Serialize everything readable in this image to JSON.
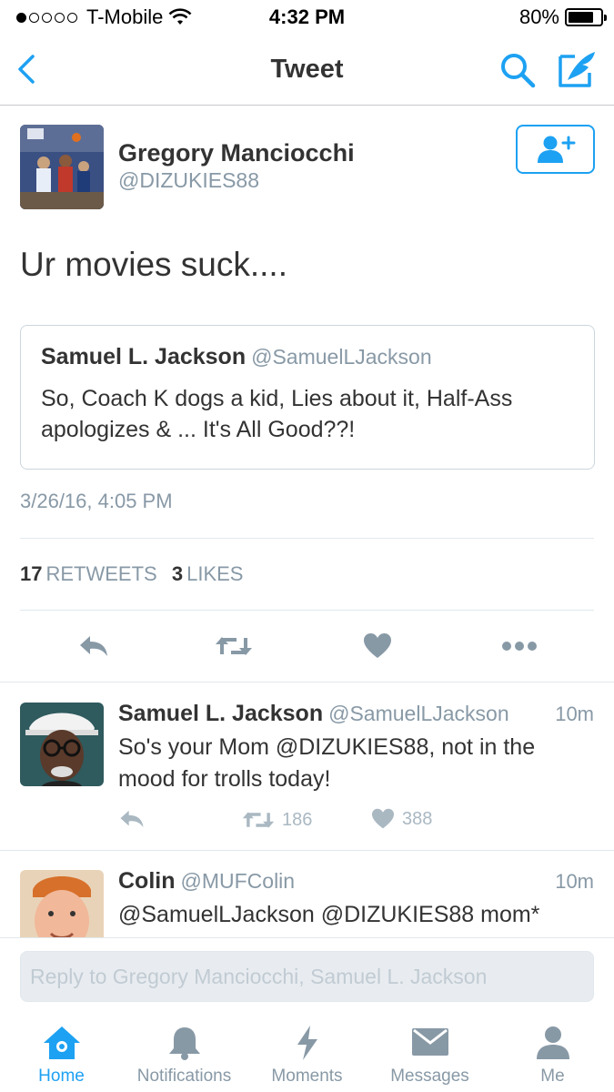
{
  "status_bar": {
    "carrier": "T-Mobile",
    "time": "4:32 PM",
    "battery": "80%",
    "battery_level": 0.8,
    "signal_bars": 1
  },
  "nav": {
    "title": "Tweet",
    "back_icon": "chevron-left-icon",
    "search_icon": "search-icon",
    "compose_icon": "compose-tweet-icon"
  },
  "tweet": {
    "author_name": "Gregory Manciocchi",
    "author_handle": "@DIZUKIES88",
    "text": "Ur movies suck....",
    "quoted": {
      "name": "Samuel L. Jackson",
      "handle": "@SamuelLJackson",
      "text": "So, Coach K dogs a kid, Lies about it, Half-Ass apologizes & ... It's All Good??!"
    },
    "timestamp": "3/26/16, 4:05 PM",
    "retweets_count": "17",
    "retweets_label": "RETWEETS",
    "likes_count": "3",
    "likes_label": "LIKES"
  },
  "replies": [
    {
      "name": "Samuel L. Jackson",
      "handle": "@SamuelLJackson",
      "time": "10m",
      "text": "So's your Mom @DIZUKIES88, not in the mood for trolls today!",
      "retweets": "186",
      "likes": "388"
    },
    {
      "name": "Colin",
      "handle": "@MUFColin",
      "time": "10m",
      "text": "@SamuelLJackson @DIZUKIES88 mom*"
    }
  ],
  "reply_box": {
    "placeholder": "Reply to Gregory Manciocchi, Samuel L. Jackson"
  },
  "tabs": [
    {
      "label": "Home",
      "icon": "home-icon",
      "active": true
    },
    {
      "label": "Notifications",
      "icon": "bell-icon",
      "active": false
    },
    {
      "label": "Moments",
      "icon": "lightning-icon",
      "active": false
    },
    {
      "label": "Messages",
      "icon": "envelope-icon",
      "active": false
    },
    {
      "label": "Me",
      "icon": "person-icon",
      "active": false
    }
  ],
  "colors": {
    "accent": "#1da1f2",
    "muted": "#8899a6",
    "icon_gray": "#aab8c2"
  }
}
